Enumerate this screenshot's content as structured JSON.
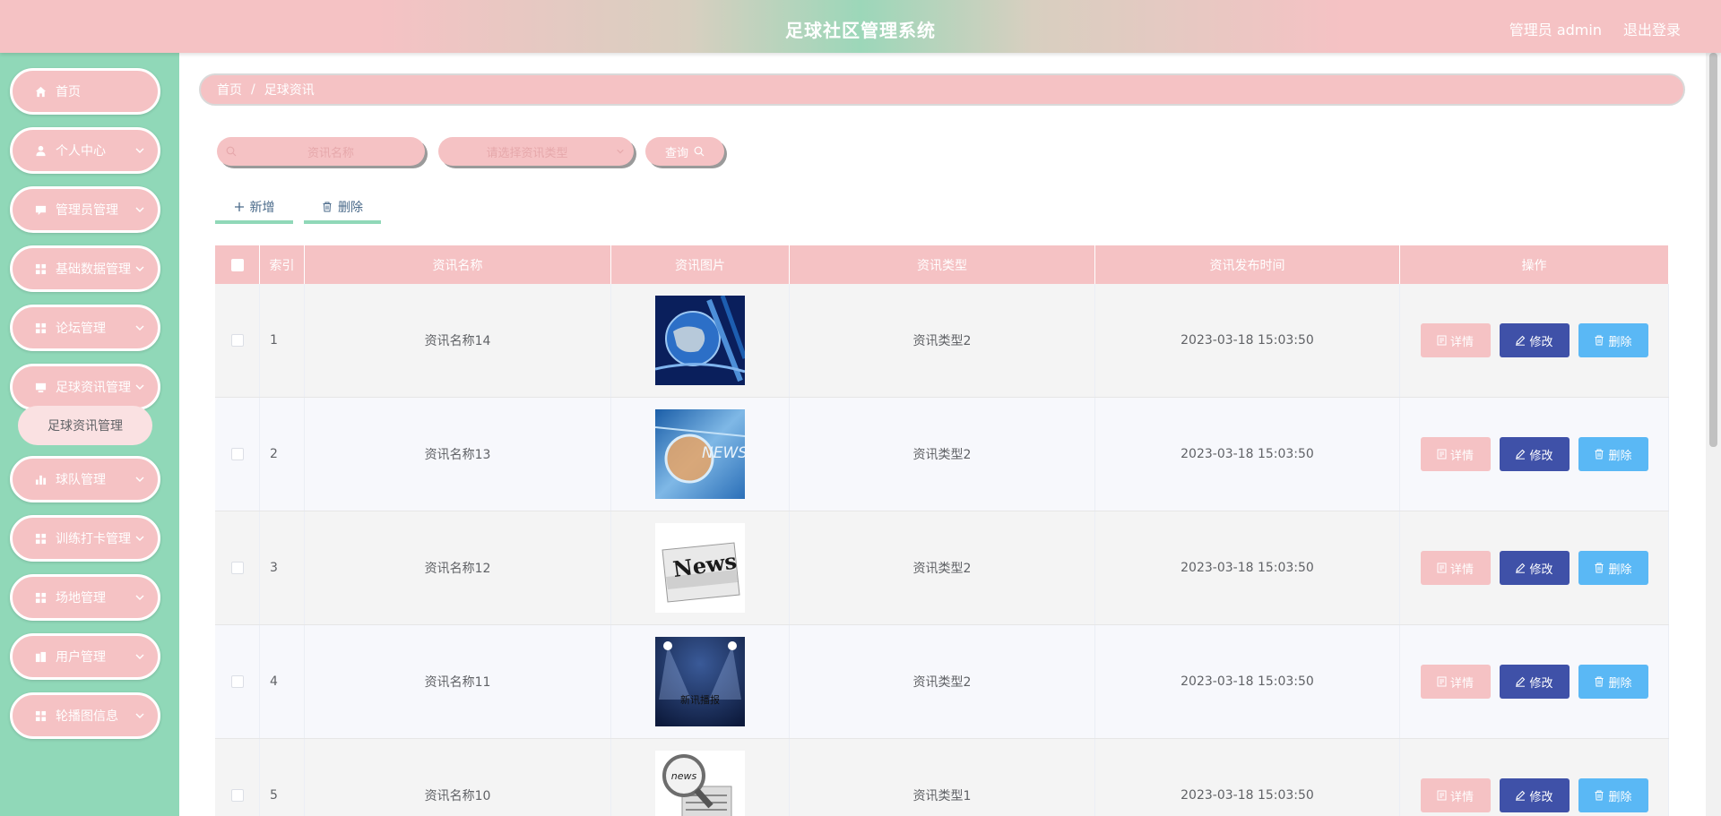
{
  "header": {
    "title": "足球社区管理系统",
    "user_label": "管理员 admin",
    "logout_label": "退出登录"
  },
  "sidebar": {
    "items": [
      {
        "label": "首页",
        "icon": "home-icon",
        "expandable": false
      },
      {
        "label": "个人中心",
        "icon": "user-icon",
        "expandable": true
      },
      {
        "label": "管理员管理",
        "icon": "chat-icon",
        "expandable": true
      },
      {
        "label": "基础数据管理",
        "icon": "grid-icon",
        "expandable": true
      },
      {
        "label": "论坛管理",
        "icon": "grid-icon",
        "expandable": true
      },
      {
        "label": "足球资讯管理",
        "icon": "monitor-icon",
        "expandable": true
      },
      {
        "label": "球队管理",
        "icon": "bar-chart-icon",
        "expandable": true
      },
      {
        "label": "训练打卡管理",
        "icon": "grid-icon",
        "expandable": true
      },
      {
        "label": "场地管理",
        "icon": "grid-icon",
        "expandable": true
      },
      {
        "label": "用户管理",
        "icon": "building-icon",
        "expandable": true
      },
      {
        "label": "轮播图信息",
        "icon": "grid-icon",
        "expandable": true
      }
    ],
    "submenu": {
      "label": "足球资讯管理"
    }
  },
  "breadcrumb": {
    "home": "首页",
    "separator": "/",
    "current": "足球资讯"
  },
  "search": {
    "name_placeholder": "资讯名称",
    "type_placeholder": "请选择资讯类型",
    "query_label": "查询"
  },
  "toolbar": {
    "add_label": "新增",
    "delete_label": "删除"
  },
  "table": {
    "columns": [
      "索引",
      "资讯名称",
      "资讯图片",
      "资讯类型",
      "资讯发布时间",
      "操作"
    ],
    "rows": [
      {
        "index": "1",
        "name": "资讯名称14",
        "image": "globe-news-image",
        "type": "资讯类型2",
        "time": "2023-03-18 15:03:50"
      },
      {
        "index": "2",
        "name": "资讯名称13",
        "image": "news-banner-image",
        "type": "资讯类型2",
        "time": "2023-03-18 15:03:50"
      },
      {
        "index": "3",
        "name": "资讯名称12",
        "image": "newspaper-image",
        "type": "资讯类型2",
        "time": "2023-03-18 15:03:50"
      },
      {
        "index": "4",
        "name": "资讯名称11",
        "image": "spotlight-news-image",
        "type": "资讯类型2",
        "time": "2023-03-18 15:03:50"
      },
      {
        "index": "5",
        "name": "资讯名称10",
        "image": "magnifier-news-image",
        "type": "资讯类型1",
        "time": "2023-03-18 15:03:50"
      }
    ],
    "actions": {
      "detail": "详情",
      "edit": "修改",
      "delete": "删除"
    }
  },
  "images": {
    "spotlight_caption": "新讯播报",
    "newspaper_word": "News",
    "banner_word": "NEWS",
    "magnifier_word": "news"
  },
  "colors": {
    "pink": "#f5c2c4",
    "mint": "#90d8b8",
    "edit_blue": "#3f51a8",
    "delete_blue": "#5ab8f5"
  }
}
